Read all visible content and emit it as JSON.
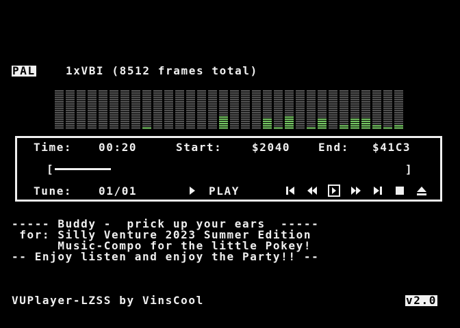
{
  "header": {
    "system": "PAL",
    "info": "1xVBI (8512 frames total)"
  },
  "vu_meter": {
    "columns": 32,
    "segments": 18,
    "levels": [
      0,
      0,
      0,
      0,
      0,
      0,
      0,
      0,
      1,
      0,
      0,
      0,
      0,
      0,
      0,
      6,
      0,
      0,
      0,
      5,
      1,
      6,
      0,
      1,
      5,
      0,
      2,
      5,
      5,
      2,
      1,
      2
    ],
    "bar_color": "#5a5a5a",
    "active_color": "#7ed46a"
  },
  "player": {
    "time_label": "Time:",
    "time_value": "00:20",
    "start_label": "Start:",
    "start_value": "$2040",
    "end_label": "End:",
    "end_value": "$41C3",
    "progress_left": "[",
    "progress_right": "]",
    "progress": 0.16,
    "tune_label": "Tune:",
    "tune_value": "01/01",
    "play_label": "PLAY",
    "controls": [
      "first-track-icon",
      "rewind-icon",
      "pause-icon",
      "fast-forward-icon",
      "last-track-icon",
      "stop-icon",
      "eject-icon"
    ]
  },
  "scroll_text": [
    "----- Buddy -  prick up your ears  -----",
    " for: Silly Venture 2023 Summer Edition",
    "      Music-Compo for the little Pokey!",
    "-- Enjoy listen and enjoy the Party!! --"
  ],
  "footer": {
    "credit": "VUPlayer-LZSS by VinsCool",
    "version": "v2.0"
  }
}
